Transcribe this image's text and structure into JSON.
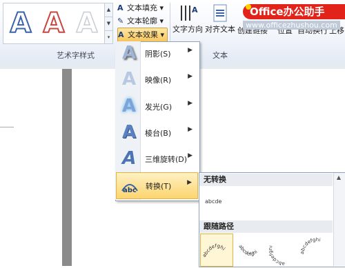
{
  "ribbon": {
    "wordart_gallery": [
      "A",
      "A",
      "A"
    ],
    "text_fill_label": "文本填充",
    "text_outline_label": "文本轮廓",
    "text_effects_label": "文本效果",
    "group_wordart_label": "艺术字样式",
    "text_direction_label": "文字方向",
    "align_text_label": "对齐文本",
    "create_link_label": "创建链接",
    "text_group_label": "文本",
    "position_label": "位置",
    "wrap_label": "自动换行",
    "bring_forward_label": "上移"
  },
  "brand": {
    "name": "Office办公助手",
    "url": "www.officezhushou.com"
  },
  "text_effects_menu": {
    "items": [
      {
        "label": "阴影(S)"
      },
      {
        "label": "映像(R)"
      },
      {
        "label": "发光(G)"
      },
      {
        "label": "棱台(B)"
      },
      {
        "label": "三维旋转(D)"
      },
      {
        "label": "转换(T)"
      }
    ]
  },
  "transform_submenu": {
    "no_transform_header": "无转换",
    "no_transform_item": "abcde",
    "follow_path_header": "跟随路径",
    "path_text": "abcdefghi"
  },
  "colors": {
    "brand_red": "#e2231a",
    "highlight": "#fbd56e"
  }
}
